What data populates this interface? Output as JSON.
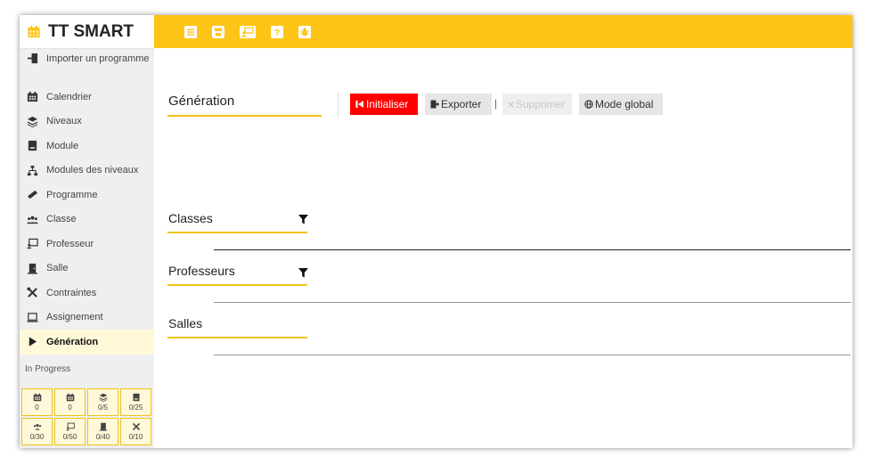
{
  "brand": {
    "title": "TT SMART",
    "icon": "calendar-icon"
  },
  "sidebar": {
    "items": [
      {
        "label": "Importer un programme",
        "icon": "import-icon",
        "active": false
      },
      {
        "label": "Calendrier",
        "icon": "calendar-icon",
        "active": false
      },
      {
        "label": "Niveaux",
        "icon": "layers-icon",
        "active": false
      },
      {
        "label": "Module",
        "icon": "book-icon",
        "active": false
      },
      {
        "label": "Modules des niveaux",
        "icon": "sitemap-icon",
        "active": false
      },
      {
        "label": "Programme",
        "icon": "ruler-icon",
        "active": false
      },
      {
        "label": "Classe",
        "icon": "users-icon",
        "active": false
      },
      {
        "label": "Professeur",
        "icon": "teacher-icon",
        "active": false
      },
      {
        "label": "Salle",
        "icon": "door-icon",
        "active": false
      },
      {
        "label": "Contraintes",
        "icon": "tools-icon",
        "active": false
      },
      {
        "label": "Assignement",
        "icon": "laptop-icon",
        "active": false
      },
      {
        "label": "Génération",
        "icon": "play-icon",
        "active": true
      }
    ],
    "progress_label": "In Progress",
    "progress": [
      {
        "icon": "calendar-icon",
        "value": "0"
      },
      {
        "icon": "calendar-icon",
        "value": "0"
      },
      {
        "icon": "layers-icon",
        "value": "0/5"
      },
      {
        "icon": "book-icon",
        "value": "0/25"
      },
      {
        "icon": "users-icon",
        "value": "0/30"
      },
      {
        "icon": "teacher-icon",
        "value": "0/50"
      },
      {
        "icon": "door-icon",
        "value": "0/40"
      },
      {
        "icon": "tools-icon",
        "value": "0/10"
      }
    ]
  },
  "toolbar": {
    "icons": [
      "menu-icon",
      "save-icon",
      "teacher-icon",
      "help-icon",
      "bug-icon"
    ],
    "help_glyph": "?"
  },
  "main": {
    "generation_title": "Génération",
    "buttons": {
      "init": "Initialiser",
      "export": "Exporter",
      "separator": "|",
      "delete": "Supprimer",
      "global": "Mode global"
    },
    "sections": {
      "classes": "Classes",
      "professeurs": "Professeurs",
      "salles": "Salles"
    }
  },
  "colors": {
    "accent": "#fec517",
    "underline": "#f0c419",
    "danger": "#ff0000",
    "active_bg": "#fff9d9"
  }
}
